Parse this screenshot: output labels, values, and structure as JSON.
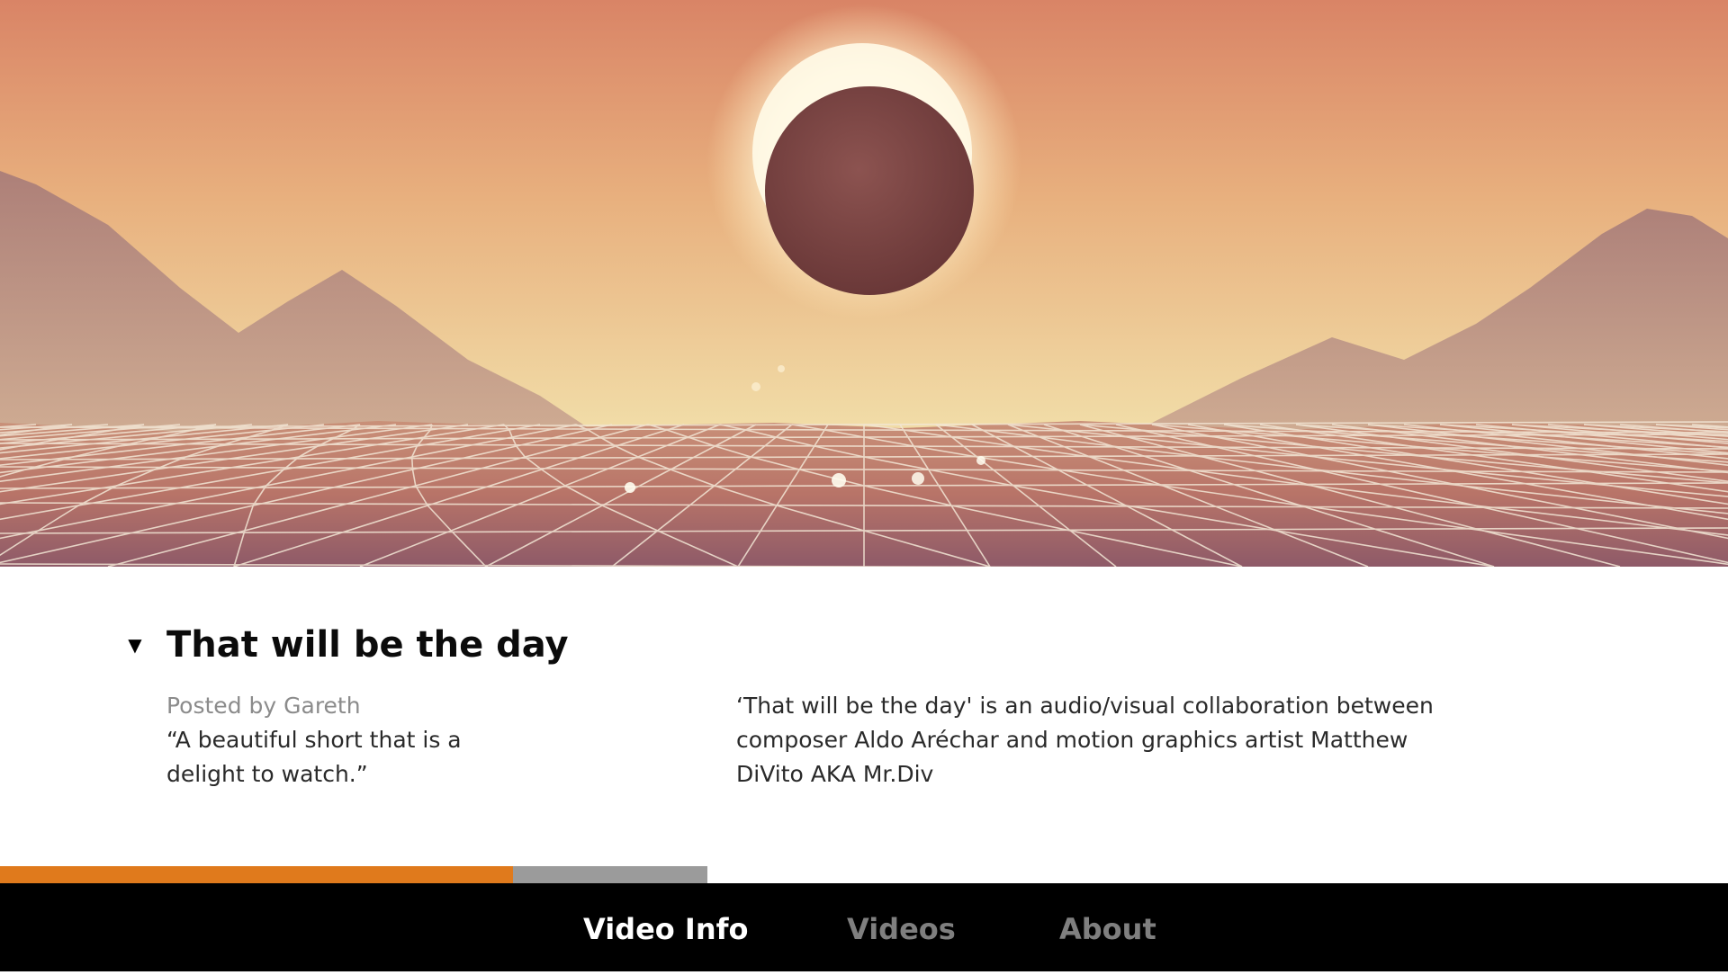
{
  "video": {
    "title": "That will be the day",
    "posted_prefix": "Posted by",
    "author": "Gareth",
    "quote_line1": "“A beautiful short that is a",
    "quote_line2": "delight to watch.”",
    "description_line1": "‘That will be the day' is an audio/visual collaboration between",
    "description_line2": "composer Aldo Aréchar and motion graphics artist Matthew",
    "description_line3": "DiVito AKA Mr.Div",
    "expand_icon": "caret-down-icon",
    "expand_glyph": "▼"
  },
  "progress": {
    "fraction": 0.725,
    "fill_color": "#e07a1c",
    "track_color": "#9b9b9b"
  },
  "nav": {
    "tabs": [
      {
        "label": "Video Info",
        "active": true
      },
      {
        "label": "Videos",
        "active": false
      },
      {
        "label": "About",
        "active": false
      }
    ]
  },
  "colors": {
    "sky_top": "#d98a6a",
    "sky_bottom": "#f0dfa6",
    "mountains": "#b58a82",
    "grid_lines": "#f3e7d6",
    "nav_background": "#000000",
    "inactive_tab": "#7f7f7f"
  }
}
